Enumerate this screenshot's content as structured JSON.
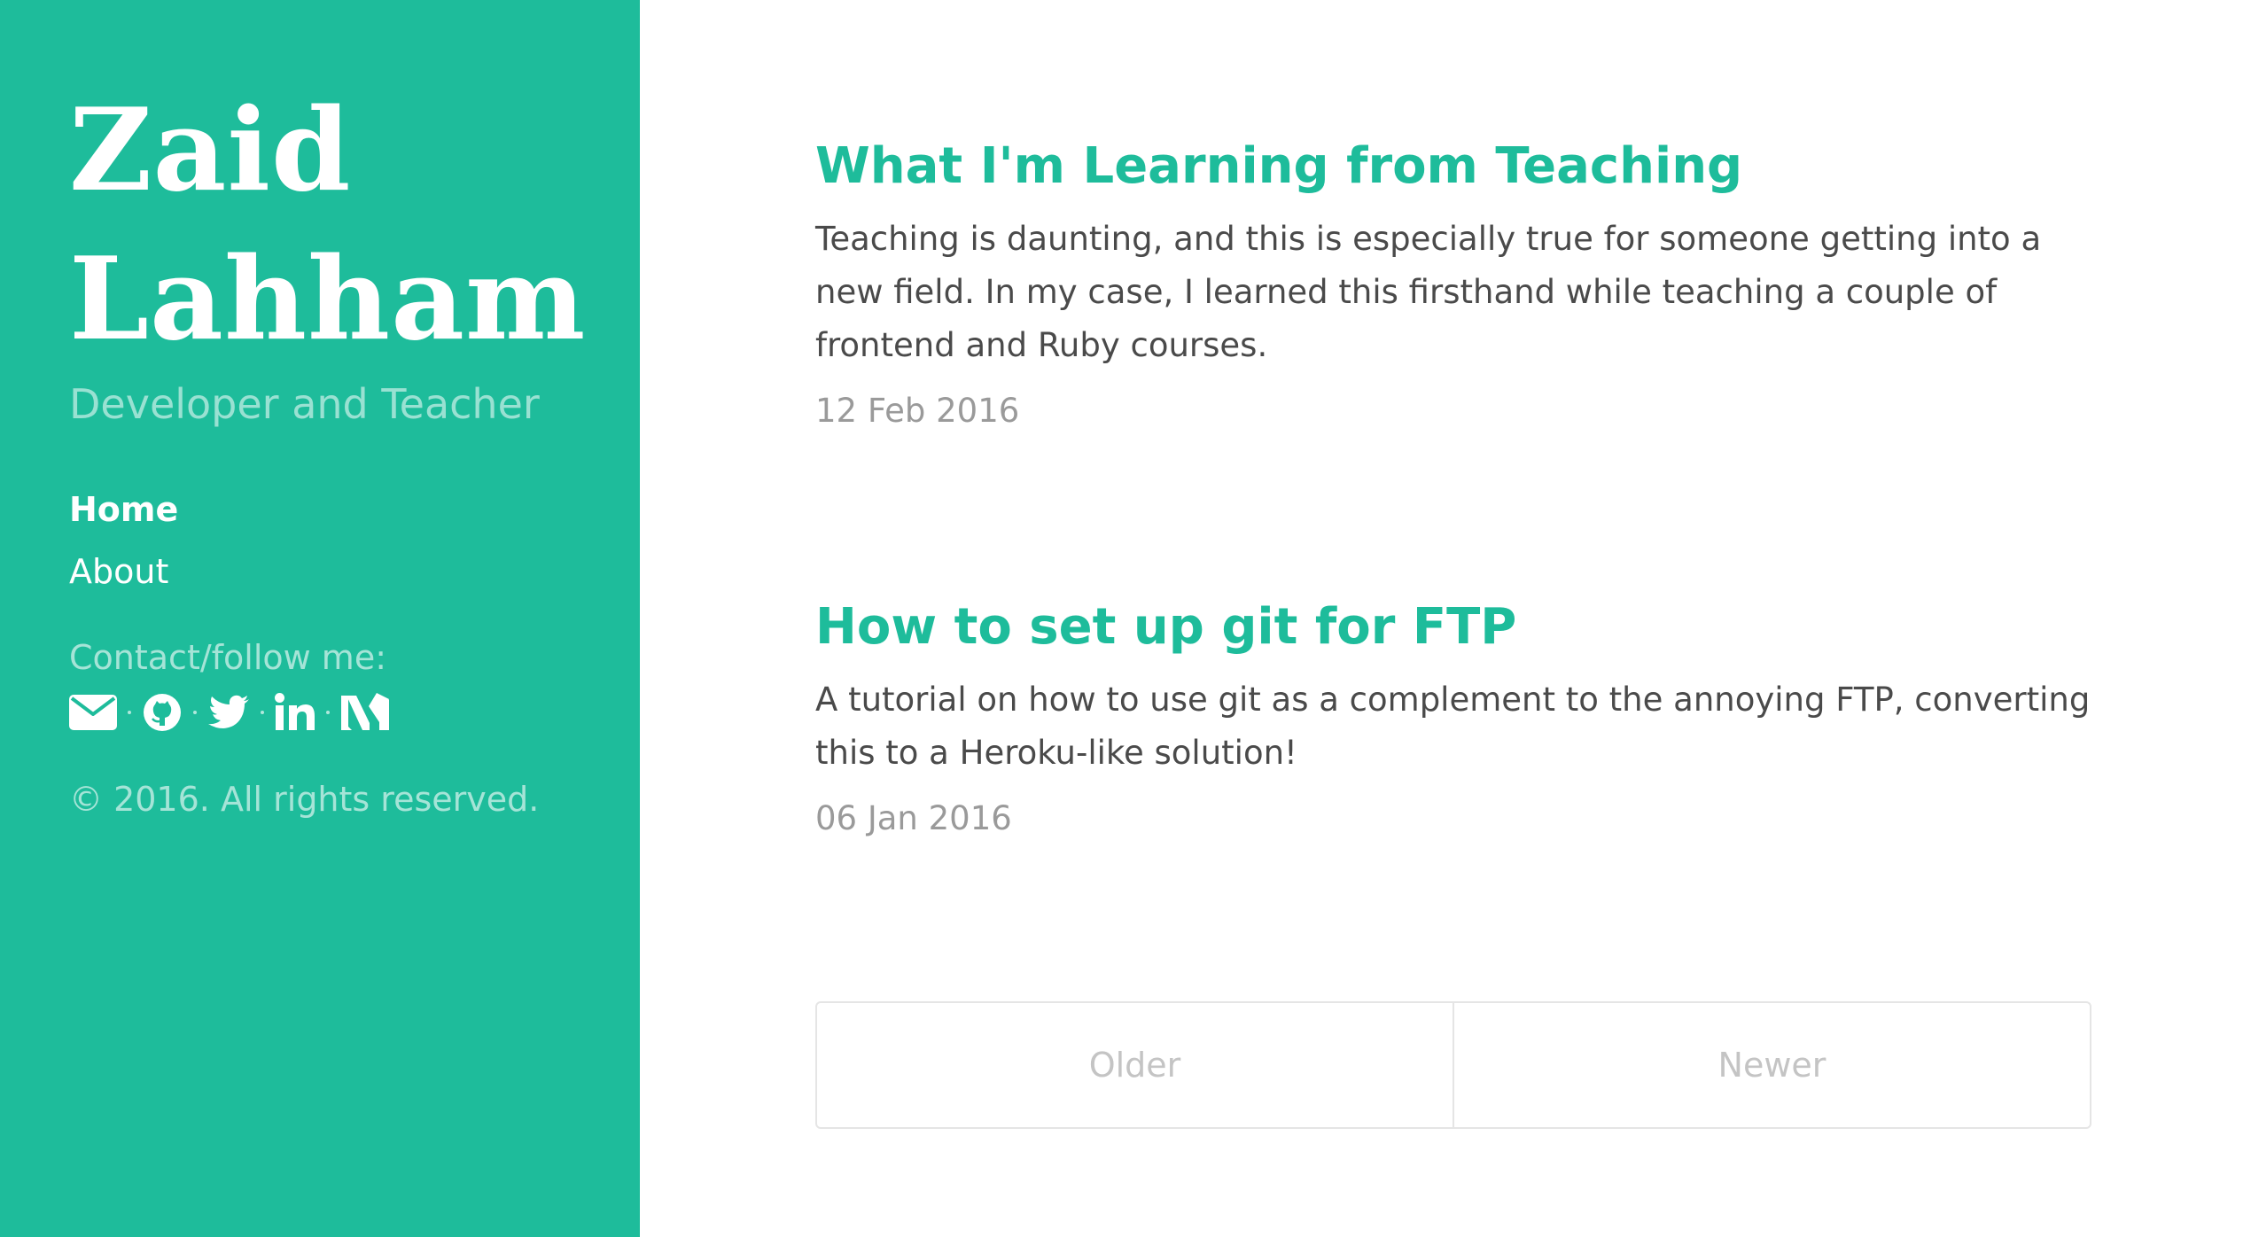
{
  "sidebar": {
    "title": "Zaid Lahham",
    "tagline": "Developer and Teacher",
    "nav": [
      {
        "label": "Home",
        "active": true
      },
      {
        "label": "About",
        "active": false
      }
    ],
    "contact_label": "Contact/follow me:",
    "social": [
      {
        "icon": "envelope-icon"
      },
      {
        "icon": "github-icon"
      },
      {
        "icon": "twitter-icon"
      },
      {
        "icon": "linkedin-icon"
      },
      {
        "icon": "medium-icon"
      }
    ],
    "copyright": "© 2016. All rights reserved."
  },
  "posts": [
    {
      "title": "What I'm Learning from Teaching",
      "excerpt": "Teaching is daunting, and this is especially true for someone getting into a new field. In my case, I learned this firsthand while teaching a couple of frontend and Ruby courses.",
      "date": "12 Feb 2016"
    },
    {
      "title": "How to set up git for FTP",
      "excerpt": "A tutorial on how to use git as a complement to the annoying FTP, converting this to a Heroku-like solution!",
      "date": "06 Jan 2016"
    }
  ],
  "pagination": {
    "older_label": "Older",
    "newer_label": "Newer"
  },
  "colors": {
    "accent": "#1ebc9b",
    "text": "#4a4a4a",
    "muted": "#9a9a9a"
  }
}
